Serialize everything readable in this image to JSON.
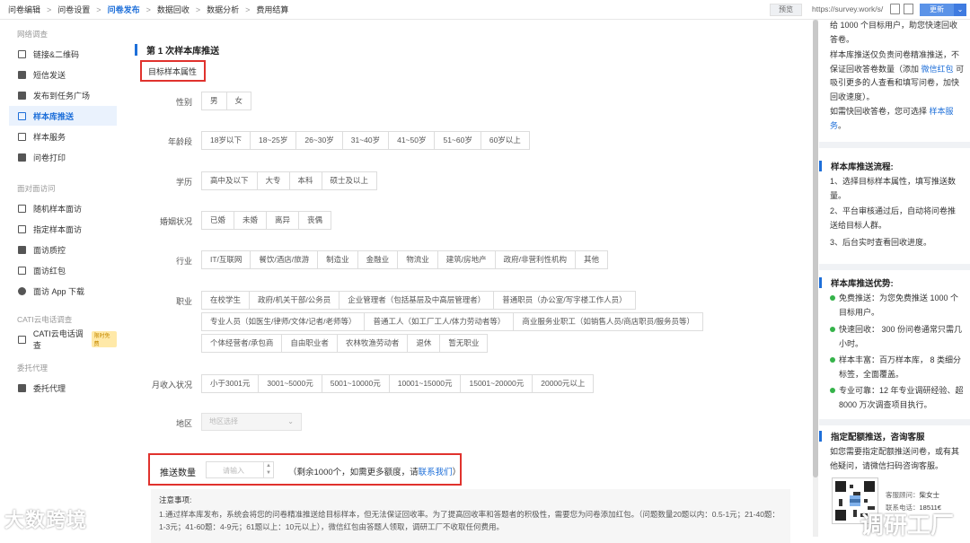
{
  "breadcrumb": {
    "items": [
      "问卷编辑",
      "问卷设置",
      "问卷发布",
      "数据回收",
      "数据分析",
      "费用结算"
    ],
    "active_index": 2,
    "separator": ">"
  },
  "toolbar": {
    "preview_label": "预览",
    "url": "https://survey.work/s/",
    "update_label": "更新",
    "dropdown_glyph": "⌄"
  },
  "sidebar": {
    "sections": [
      {
        "title": "网络调查",
        "items": [
          {
            "label": "链接&二维码",
            "icon": "link-icon"
          },
          {
            "label": "短信发送",
            "icon": "sms-icon"
          },
          {
            "label": "发布到任务广场",
            "icon": "send-icon"
          },
          {
            "label": "样本库推送",
            "icon": "sample-push-icon",
            "active": true
          },
          {
            "label": "样本服务",
            "icon": "service-icon"
          },
          {
            "label": "问卷打印",
            "icon": "print-icon"
          }
        ]
      },
      {
        "title": "面对面访问",
        "items": [
          {
            "label": "随机样本面访",
            "icon": "random-icon"
          },
          {
            "label": "指定样本面访",
            "icon": "assign-icon"
          },
          {
            "label": "面访质控",
            "icon": "shield-icon"
          },
          {
            "label": "面访红包",
            "icon": "redpacket-icon"
          },
          {
            "label": "面访 App 下载",
            "icon": "android-icon"
          }
        ]
      },
      {
        "title": "CATI云电话调查",
        "items": [
          {
            "label": "CATI云电话调查",
            "icon": "phone-icon",
            "badge": "限时免费"
          }
        ]
      },
      {
        "title": "委托代理",
        "items": [
          {
            "label": "委托代理",
            "icon": "handshake-icon"
          }
        ]
      }
    ]
  },
  "main": {
    "section_title": "第 1 次样本库推送",
    "target_attr_label": "目标样本属性",
    "rows": [
      {
        "label": "性别",
        "options": [
          "男",
          "女"
        ]
      },
      {
        "label": "年龄段",
        "options": [
          "18岁以下",
          "18~25岁",
          "26~30岁",
          "31~40岁",
          "41~50岁",
          "51~60岁",
          "60岁以上"
        ]
      },
      {
        "label": "学历",
        "options": [
          "高中及以下",
          "大专",
          "本科",
          "硕士及以上"
        ]
      },
      {
        "label": "婚姻状况",
        "options": [
          "已婚",
          "未婚",
          "离异",
          "丧偶"
        ]
      },
      {
        "label": "行业",
        "options": [
          "IT/互联网",
          "餐饮/酒店/旅游",
          "制造业",
          "金融业",
          "物流业",
          "建筑/房地产",
          "政府/非营利性机构",
          "其他"
        ]
      },
      {
        "label": "职业",
        "options_lines": [
          [
            "在校学生",
            "政府/机关干部/公务员",
            "企业管理者（包括基层及中高层管理者）",
            "普通职员（办公室/写字楼工作人员）"
          ],
          [
            "专业人员（如医生/律师/文体/记者/老师等）",
            "普通工人（如工厂工人/体力劳动者等）",
            "商业服务业职工（如销售人员/商店职员/服务员等）"
          ],
          [
            "个体经营者/承包商",
            "自由职业者",
            "农林牧渔劳动者",
            "退休",
            "暂无职业"
          ]
        ]
      },
      {
        "label": "月收入状况",
        "options": [
          "小于3001元",
          "3001~5000元",
          "5001~10000元",
          "10001~15000元",
          "15001~20000元",
          "20000元以上"
        ]
      }
    ],
    "region_label": "地区",
    "region_placeholder": "地区选择",
    "push_label": "推送数量",
    "push_placeholder": "请输入",
    "remain_prefix": "（剩余1000个，如需更多额度，请",
    "remain_link": "联系我们",
    "remain_suffix": "）",
    "notice_title": "注意事项:",
    "notice_body": "1.通过样本库发布，系统会将您的问卷精准推送给目标样本，但无法保证回收率。为了提高回收率和答题者的积极性，需要您为问卷添加红包。（问题数量20题以内：0.5-1元；21-40题：1-3元；41-60题：4-9元；61题以上：10元以上），微信红包由答题人领取，调研工厂不收取任何费用。"
  },
  "right_panel": {
    "intro_top": "给 1000 个目标用户，助您快速回收答卷。",
    "intro_mid_pre": "样本库推送仅负责问卷精准推送，不保证回收答卷数量（添加",
    "intro_mid_link": "微信红包",
    "intro_mid_post": "可吸引更多的人查看和填写问卷，加快回收速度）。",
    "intro_fast_pre": "如需快回收答卷，您可选择",
    "intro_fast_link": "样本服务",
    "intro_fast_post": "。",
    "flow_title": "样本库推送流程:",
    "flow_steps": [
      "1、选择目标样本属性，填写推送数量。",
      "2、平台审核通过后，自动将问卷推送给目标人群。",
      "3、后台实时查看回收进度。"
    ],
    "adv_title": "样本库推送优势:",
    "advantages": [
      "免费推送：为您免费推送 1000 个目标用户。",
      "快速回收： 300 份问卷通常只需几小时。",
      "样本丰富：百万样本库， 8 类细分标签，全面覆盖。",
      "专业可靠：12 年专业调研经验、超 8000 万次调查项目执行。"
    ],
    "quota_title": "指定配额推送，咨询客服",
    "quota_desc": "如您需要指定配额推送问卷，或有其他疑问，请微信扫码咨询客服。",
    "consultant_label": "客服顾问：",
    "consultant_name": "柴女士",
    "phone_label": "联系电话：",
    "phone_value": "18511€"
  },
  "watermarks": {
    "left": "大数跨境",
    "right": "调研工厂"
  },
  "colors": {
    "accent": "#1e6fd9",
    "highlight_box": "#e0322d",
    "advantage_dot": "#35b34a"
  }
}
